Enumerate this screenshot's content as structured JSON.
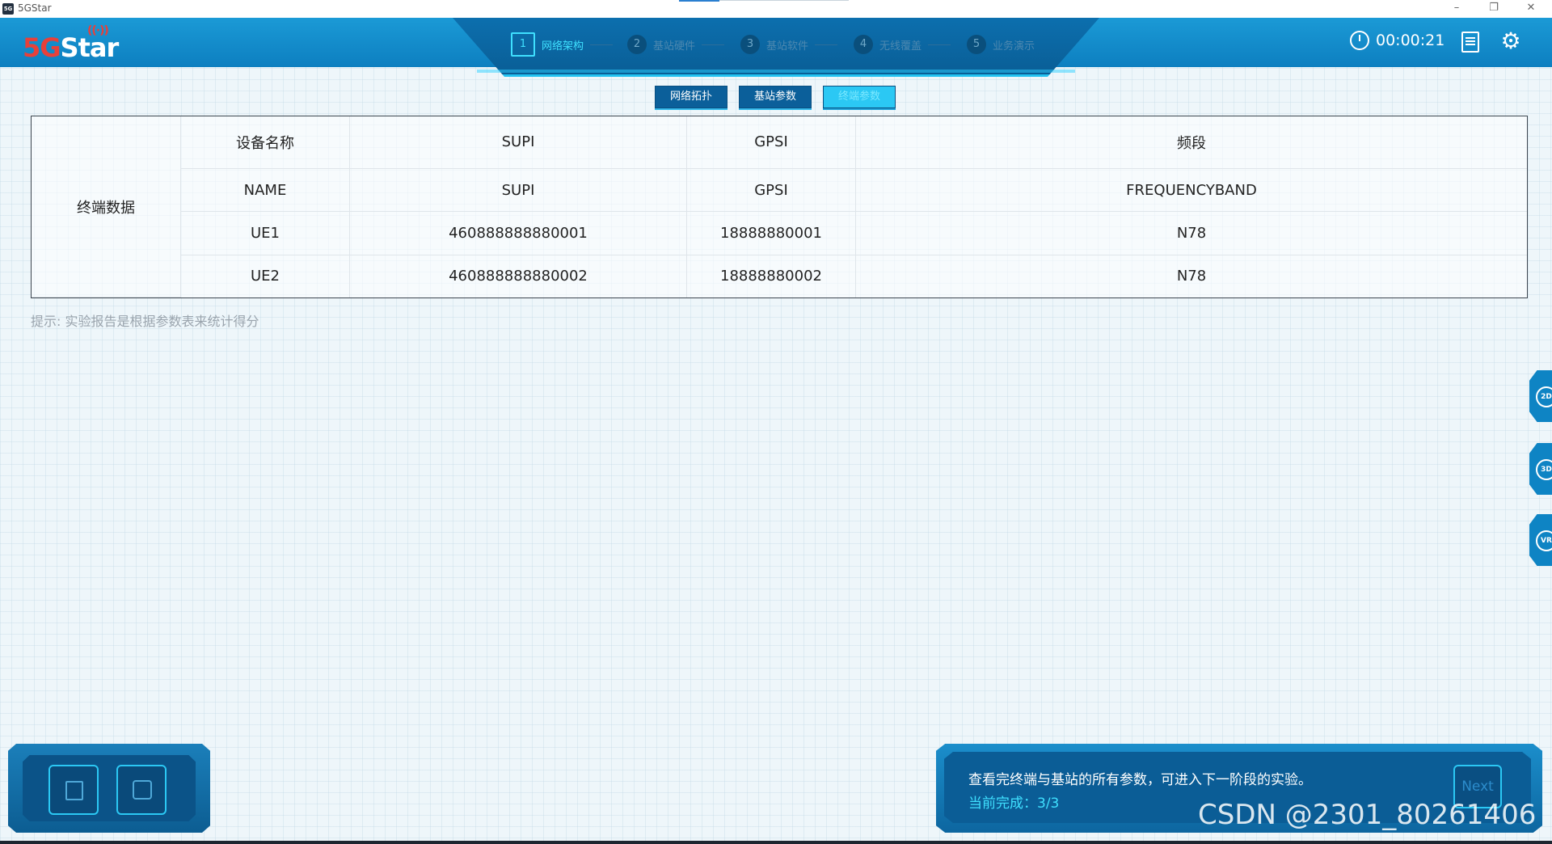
{
  "window": {
    "title": "5GStar",
    "icon_text": "5G",
    "controls": [
      "–",
      "❐",
      "✕"
    ]
  },
  "header": {
    "logo_five": "5G",
    "logo_star": "Star",
    "timer": "00:00:21",
    "steps": [
      {
        "num": "1",
        "label": "网络架构",
        "active": true
      },
      {
        "num": "2",
        "label": "基站硬件",
        "active": false
      },
      {
        "num": "3",
        "label": "基站软件",
        "active": false
      },
      {
        "num": "4",
        "label": "无线覆盖",
        "active": false
      },
      {
        "num": "5",
        "label": "业务演示",
        "active": false
      }
    ]
  },
  "subtabs": [
    {
      "label": "网络拓扑",
      "active": false
    },
    {
      "label": "基站参数",
      "active": false
    },
    {
      "label": "终端参数",
      "active": true
    }
  ],
  "table": {
    "side_label": "终端数据",
    "header_row": [
      "设备名称",
      "SUPI",
      "GPSI",
      "频段"
    ],
    "rows": [
      [
        "NAME",
        "SUPI",
        "GPSI",
        "FREQUENCYBAND"
      ],
      [
        "UE1",
        "460888888880001",
        "18888880001",
        "N78"
      ],
      [
        "UE2",
        "460888888880002",
        "18888880002",
        "N78"
      ]
    ]
  },
  "hint": "提示: 实验报告是根据参数表来统计得分",
  "side_buttons": [
    "2D",
    "3D",
    "VR"
  ],
  "bottom_panel": {
    "message": "查看完终端与基站的所有参数，可进入下一阶段的实验。",
    "progress_label": "当前完成：3/3",
    "next_label": "Next"
  },
  "watermark": "CSDN @2301_80261406",
  "colors": {
    "header_blue": "#1b9ad6",
    "accent_cyan": "#3fe0ff",
    "logo_red": "#e8403a"
  }
}
